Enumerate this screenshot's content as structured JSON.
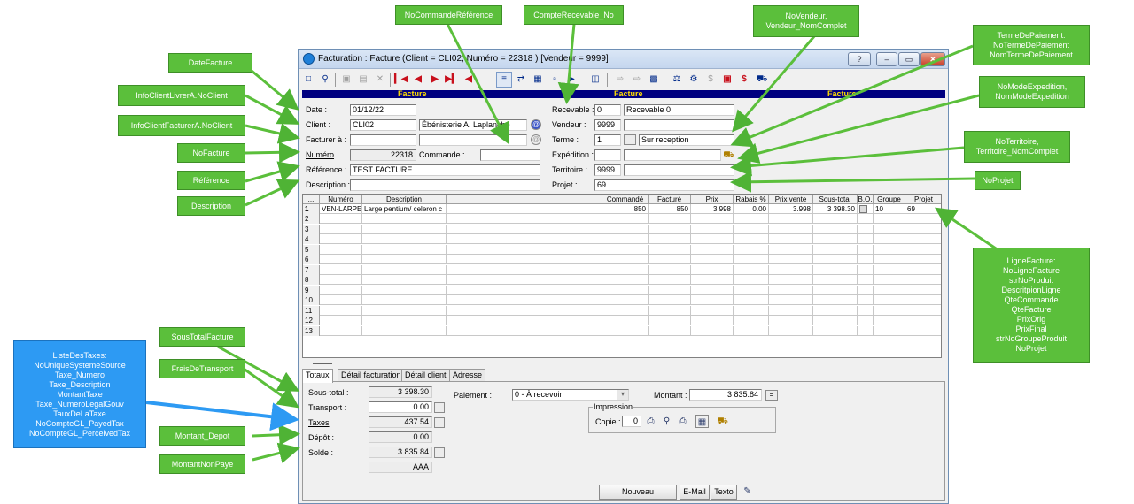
{
  "window": {
    "title": "Facturation : Facture (Client = CLI02, Numéro = 22318 ) [Vendeur = 9999]",
    "controls": [
      "?",
      "–",
      "▭",
      "✕"
    ]
  },
  "band": [
    "Facture",
    "Facture",
    "Facture"
  ],
  "left_form": {
    "date_label": "Date :",
    "date_value": "01/12/22",
    "client_label": "Client :",
    "client_code": "CLI02",
    "client_name": "Ébénisterie A. Laplanche",
    "facturer_label": "Facturer à :",
    "facturer_code": "",
    "facturer_name": "",
    "numero_label": "Numéro",
    "numero_value": "22318",
    "commande_label": "Commande :",
    "commande_value": "",
    "reference_label": "Référence :",
    "reference_value": "TEST FACTURE",
    "description_label": "Description :",
    "description_value": ""
  },
  "right_form": {
    "recevable_label": "Recevable :",
    "recevable_code": "0",
    "recevable_name": "Recevable 0",
    "vendeur_label": "Vendeur :",
    "vendeur_code": "9999",
    "vendeur_name": "",
    "terme_label": "Terme :",
    "terme_code": "1",
    "terme_name": "Sur reception",
    "expedition_label": "Expédition :",
    "expedition_code": "",
    "expedition_name": "",
    "territoire_label": "Territoire :",
    "territoire_code": "9999",
    "territoire_name": "",
    "projet_label": "Projet :",
    "projet_value": "69"
  },
  "grid": {
    "headers": [
      "...",
      "Numéro",
      "Description",
      "",
      "",
      "",
      "",
      "Commandé",
      "Facturé",
      "Prix",
      "Rabais %",
      "Prix vente",
      "Sous-total",
      "B.O.",
      "Groupe",
      "Projet"
    ],
    "row1": {
      "n": "1",
      "numero": "VEN-LARPE",
      "description": "Large pentium/ celeron c",
      "commande": "850",
      "facture": "850",
      "prix": "3.998",
      "rabais": "0.00",
      "prix_vente": "3.998",
      "sous_total": "3 398.30",
      "groupe": "10",
      "projet": "69"
    },
    "row_numbers": [
      "2",
      "3",
      "4",
      "5",
      "6",
      "7",
      "8",
      "9",
      "10",
      "11",
      "12",
      "13"
    ]
  },
  "tabs": [
    "Totaux",
    "Détail facturation",
    "Détail client",
    "Adresse"
  ],
  "totals": {
    "sous_total_label": "Sous-total :",
    "sous_total_value": "3 398.30",
    "transport_label": "Transport :",
    "transport_value": "0.00",
    "taxes_label": "Taxes",
    "taxes_value": "437.54",
    "depot_label": "Dépôt :",
    "depot_value": "0.00",
    "solde_label": "Solde :",
    "solde_value": "3 835.84",
    "extra_value": "AAA"
  },
  "payment": {
    "paiement_label": "Paiement :",
    "paiement_value": "0 - À recevoir",
    "montant_label": "Montant :",
    "montant_value": "3 835.84",
    "equals": "=",
    "impression_label": "Impression",
    "copie_label": "Copie :",
    "copie_value": "0"
  },
  "buttons": {
    "nouveau": "Nouveau",
    "email": "E-Mail",
    "texto": "Texto",
    "ellipsis": "..."
  },
  "callouts": {
    "nocommande": "NoCommandeRéférence",
    "recevable": "CompteRecevable_No",
    "vendeur": [
      "NoVendeur,",
      "Vendeur_NomComplet"
    ],
    "terme": [
      "TermeDePaiement:",
      "NoTermeDePaiement",
      "NomTermeDePaiement"
    ],
    "expedition": [
      "NoModeExpedition,",
      "NomModeExpedition"
    ],
    "territoire": [
      "NoTerritoire,",
      "Territoire_NomComplet"
    ],
    "projet": "NoProjet",
    "datefacture": "DateFacture",
    "livrer": "InfoClientLivrerA.NoClient",
    "facturer": "InfoClientFacturerA.NoClient",
    "nofacture": "NoFacture",
    "reference": "Référence",
    "description": "Description",
    "lignefacture": [
      "LigneFacture:",
      "NoLigneFacture",
      "strNoProduit",
      "DescritpionLigne",
      "QteCommande",
      "QteFacture",
      "PrixOrig",
      "PrixFinal",
      "strNoGroupeProduit",
      "NoProjet"
    ],
    "soustotal": "SousTotalFacture",
    "frais": "FraisDeTransport",
    "taxes": [
      "ListeDesTaxes:",
      "NoUniqueSystemeSource",
      "Taxe_Numero",
      "Taxe_Description",
      "MontantTaxe",
      "Taxe_NumeroLegalGouv",
      "TauxDeLaTaxe",
      "NoCompteGL_PayedTax",
      "NoCompteGL_PerceivedTax"
    ],
    "depot": "Montant_Depot",
    "nonpaye": "MontantNonPaye"
  },
  "colors": {
    "band": "#000080",
    "band_text": "#ffdd00",
    "callout_green": "#5bbf3b",
    "callout_blue": "#2d9af3"
  }
}
